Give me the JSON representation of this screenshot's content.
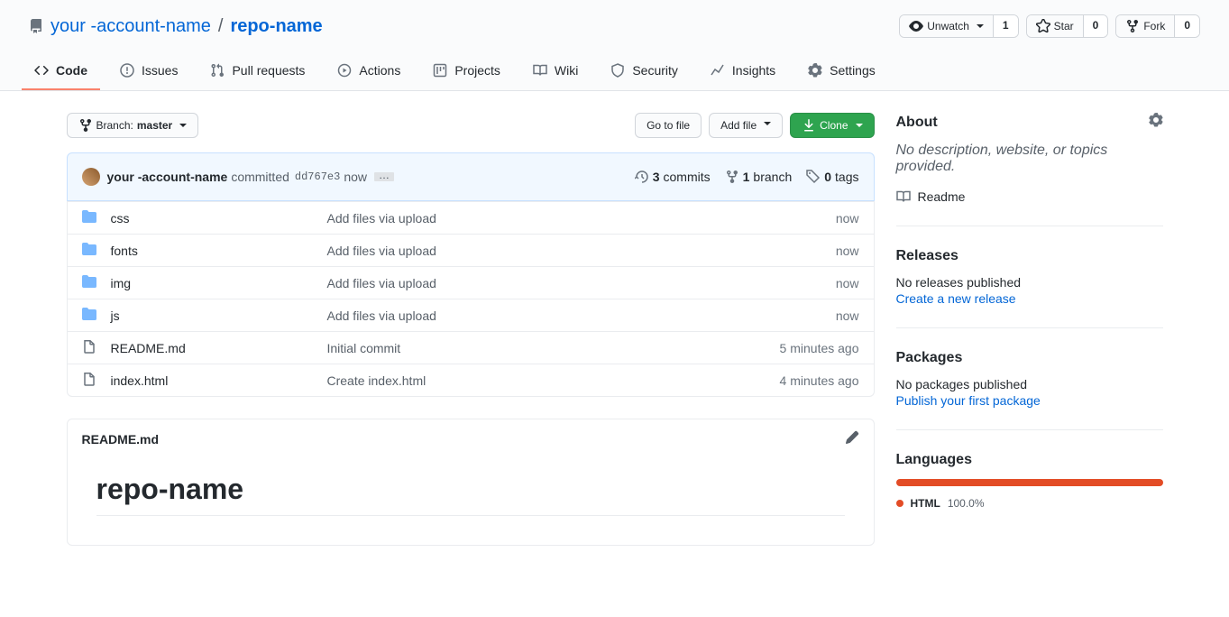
{
  "breadcrumb": {
    "icon": "repo",
    "owner": "your -account-name",
    "sep": "/",
    "repo": "repo-name"
  },
  "actions": {
    "watch": {
      "label": "Unwatch",
      "count": "1"
    },
    "star": {
      "label": "Star",
      "count": "0"
    },
    "fork": {
      "label": "Fork",
      "count": "0"
    }
  },
  "tabs": [
    {
      "label": "Code",
      "active": true
    },
    {
      "label": "Issues"
    },
    {
      "label": "Pull requests"
    },
    {
      "label": "Actions"
    },
    {
      "label": "Projects"
    },
    {
      "label": "Wiki"
    },
    {
      "label": "Security"
    },
    {
      "label": "Insights"
    },
    {
      "label": "Settings"
    }
  ],
  "toolbar": {
    "branch_prefix": "Branch:",
    "branch": "master",
    "goto": "Go to file",
    "addfile": "Add file",
    "clone": "Clone"
  },
  "commitbar": {
    "author": "your -account-name",
    "msg": "committed",
    "hash": "dd767e3",
    "time": "now",
    "ellipsis": "…",
    "stats": {
      "commits_n": "3",
      "commits": "commits",
      "branches_n": "1",
      "branches": "branch",
      "tags_n": "0",
      "tags": "tags"
    }
  },
  "files": [
    {
      "type": "folder",
      "name": "css",
      "msg": "Add files via upload",
      "ago": "now"
    },
    {
      "type": "folder",
      "name": "fonts",
      "msg": "Add files via upload",
      "ago": "now"
    },
    {
      "type": "folder",
      "name": "img",
      "msg": "Add files via upload",
      "ago": "now"
    },
    {
      "type": "folder",
      "name": "js",
      "msg": "Add files via upload",
      "ago": "now"
    },
    {
      "type": "file",
      "name": "README.md",
      "msg": "Initial commit",
      "ago": "5 minutes ago"
    },
    {
      "type": "file",
      "name": "index.html",
      "msg": "Create index.html",
      "ago": "4 minutes ago"
    }
  ],
  "readme": {
    "filename": "README.md",
    "heading": "repo-name"
  },
  "sidebar": {
    "about": {
      "title": "About",
      "desc": "No description, website, or topics provided.",
      "readme": "Readme"
    },
    "releases": {
      "title": "Releases",
      "none": "No releases published",
      "link": "Create a new release"
    },
    "packages": {
      "title": "Packages",
      "none": "No packages published",
      "link": "Publish your first package"
    },
    "languages": {
      "title": "Languages",
      "name": "HTML",
      "pct": "100.0%"
    }
  }
}
